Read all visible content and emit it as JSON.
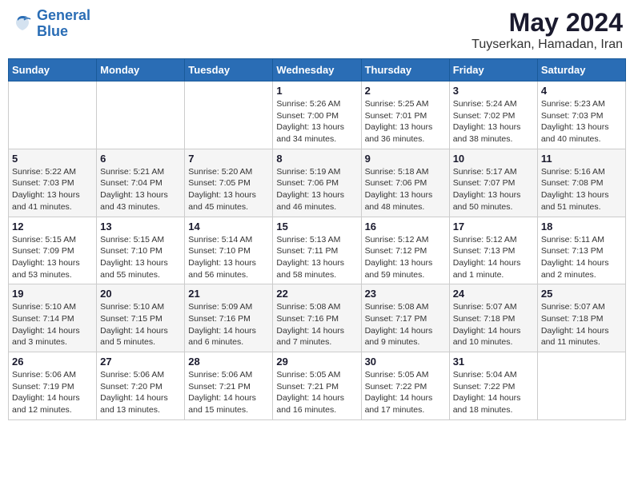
{
  "logo": {
    "line1": "General",
    "line2": "Blue"
  },
  "title": "May 2024",
  "subtitle": "Tuyserkan, Hamadan, Iran",
  "weekdays": [
    "Sunday",
    "Monday",
    "Tuesday",
    "Wednesday",
    "Thursday",
    "Friday",
    "Saturday"
  ],
  "weeks": [
    [
      {
        "day": "",
        "sunrise": "",
        "sunset": "",
        "daylight": ""
      },
      {
        "day": "",
        "sunrise": "",
        "sunset": "",
        "daylight": ""
      },
      {
        "day": "",
        "sunrise": "",
        "sunset": "",
        "daylight": ""
      },
      {
        "day": "1",
        "sunrise": "Sunrise: 5:26 AM",
        "sunset": "Sunset: 7:00 PM",
        "daylight": "Daylight: 13 hours and 34 minutes."
      },
      {
        "day": "2",
        "sunrise": "Sunrise: 5:25 AM",
        "sunset": "Sunset: 7:01 PM",
        "daylight": "Daylight: 13 hours and 36 minutes."
      },
      {
        "day": "3",
        "sunrise": "Sunrise: 5:24 AM",
        "sunset": "Sunset: 7:02 PM",
        "daylight": "Daylight: 13 hours and 38 minutes."
      },
      {
        "day": "4",
        "sunrise": "Sunrise: 5:23 AM",
        "sunset": "Sunset: 7:03 PM",
        "daylight": "Daylight: 13 hours and 40 minutes."
      }
    ],
    [
      {
        "day": "5",
        "sunrise": "Sunrise: 5:22 AM",
        "sunset": "Sunset: 7:03 PM",
        "daylight": "Daylight: 13 hours and 41 minutes."
      },
      {
        "day": "6",
        "sunrise": "Sunrise: 5:21 AM",
        "sunset": "Sunset: 7:04 PM",
        "daylight": "Daylight: 13 hours and 43 minutes."
      },
      {
        "day": "7",
        "sunrise": "Sunrise: 5:20 AM",
        "sunset": "Sunset: 7:05 PM",
        "daylight": "Daylight: 13 hours and 45 minutes."
      },
      {
        "day": "8",
        "sunrise": "Sunrise: 5:19 AM",
        "sunset": "Sunset: 7:06 PM",
        "daylight": "Daylight: 13 hours and 46 minutes."
      },
      {
        "day": "9",
        "sunrise": "Sunrise: 5:18 AM",
        "sunset": "Sunset: 7:06 PM",
        "daylight": "Daylight: 13 hours and 48 minutes."
      },
      {
        "day": "10",
        "sunrise": "Sunrise: 5:17 AM",
        "sunset": "Sunset: 7:07 PM",
        "daylight": "Daylight: 13 hours and 50 minutes."
      },
      {
        "day": "11",
        "sunrise": "Sunrise: 5:16 AM",
        "sunset": "Sunset: 7:08 PM",
        "daylight": "Daylight: 13 hours and 51 minutes."
      }
    ],
    [
      {
        "day": "12",
        "sunrise": "Sunrise: 5:15 AM",
        "sunset": "Sunset: 7:09 PM",
        "daylight": "Daylight: 13 hours and 53 minutes."
      },
      {
        "day": "13",
        "sunrise": "Sunrise: 5:15 AM",
        "sunset": "Sunset: 7:10 PM",
        "daylight": "Daylight: 13 hours and 55 minutes."
      },
      {
        "day": "14",
        "sunrise": "Sunrise: 5:14 AM",
        "sunset": "Sunset: 7:10 PM",
        "daylight": "Daylight: 13 hours and 56 minutes."
      },
      {
        "day": "15",
        "sunrise": "Sunrise: 5:13 AM",
        "sunset": "Sunset: 7:11 PM",
        "daylight": "Daylight: 13 hours and 58 minutes."
      },
      {
        "day": "16",
        "sunrise": "Sunrise: 5:12 AM",
        "sunset": "Sunset: 7:12 PM",
        "daylight": "Daylight: 13 hours and 59 minutes."
      },
      {
        "day": "17",
        "sunrise": "Sunrise: 5:12 AM",
        "sunset": "Sunset: 7:13 PM",
        "daylight": "Daylight: 14 hours and 1 minute."
      },
      {
        "day": "18",
        "sunrise": "Sunrise: 5:11 AM",
        "sunset": "Sunset: 7:13 PM",
        "daylight": "Daylight: 14 hours and 2 minutes."
      }
    ],
    [
      {
        "day": "19",
        "sunrise": "Sunrise: 5:10 AM",
        "sunset": "Sunset: 7:14 PM",
        "daylight": "Daylight: 14 hours and 3 minutes."
      },
      {
        "day": "20",
        "sunrise": "Sunrise: 5:10 AM",
        "sunset": "Sunset: 7:15 PM",
        "daylight": "Daylight: 14 hours and 5 minutes."
      },
      {
        "day": "21",
        "sunrise": "Sunrise: 5:09 AM",
        "sunset": "Sunset: 7:16 PM",
        "daylight": "Daylight: 14 hours and 6 minutes."
      },
      {
        "day": "22",
        "sunrise": "Sunrise: 5:08 AM",
        "sunset": "Sunset: 7:16 PM",
        "daylight": "Daylight: 14 hours and 7 minutes."
      },
      {
        "day": "23",
        "sunrise": "Sunrise: 5:08 AM",
        "sunset": "Sunset: 7:17 PM",
        "daylight": "Daylight: 14 hours and 9 minutes."
      },
      {
        "day": "24",
        "sunrise": "Sunrise: 5:07 AM",
        "sunset": "Sunset: 7:18 PM",
        "daylight": "Daylight: 14 hours and 10 minutes."
      },
      {
        "day": "25",
        "sunrise": "Sunrise: 5:07 AM",
        "sunset": "Sunset: 7:18 PM",
        "daylight": "Daylight: 14 hours and 11 minutes."
      }
    ],
    [
      {
        "day": "26",
        "sunrise": "Sunrise: 5:06 AM",
        "sunset": "Sunset: 7:19 PM",
        "daylight": "Daylight: 14 hours and 12 minutes."
      },
      {
        "day": "27",
        "sunrise": "Sunrise: 5:06 AM",
        "sunset": "Sunset: 7:20 PM",
        "daylight": "Daylight: 14 hours and 13 minutes."
      },
      {
        "day": "28",
        "sunrise": "Sunrise: 5:06 AM",
        "sunset": "Sunset: 7:21 PM",
        "daylight": "Daylight: 14 hours and 15 minutes."
      },
      {
        "day": "29",
        "sunrise": "Sunrise: 5:05 AM",
        "sunset": "Sunset: 7:21 PM",
        "daylight": "Daylight: 14 hours and 16 minutes."
      },
      {
        "day": "30",
        "sunrise": "Sunrise: 5:05 AM",
        "sunset": "Sunset: 7:22 PM",
        "daylight": "Daylight: 14 hours and 17 minutes."
      },
      {
        "day": "31",
        "sunrise": "Sunrise: 5:04 AM",
        "sunset": "Sunset: 7:22 PM",
        "daylight": "Daylight: 14 hours and 18 minutes."
      },
      {
        "day": "",
        "sunrise": "",
        "sunset": "",
        "daylight": ""
      }
    ]
  ]
}
